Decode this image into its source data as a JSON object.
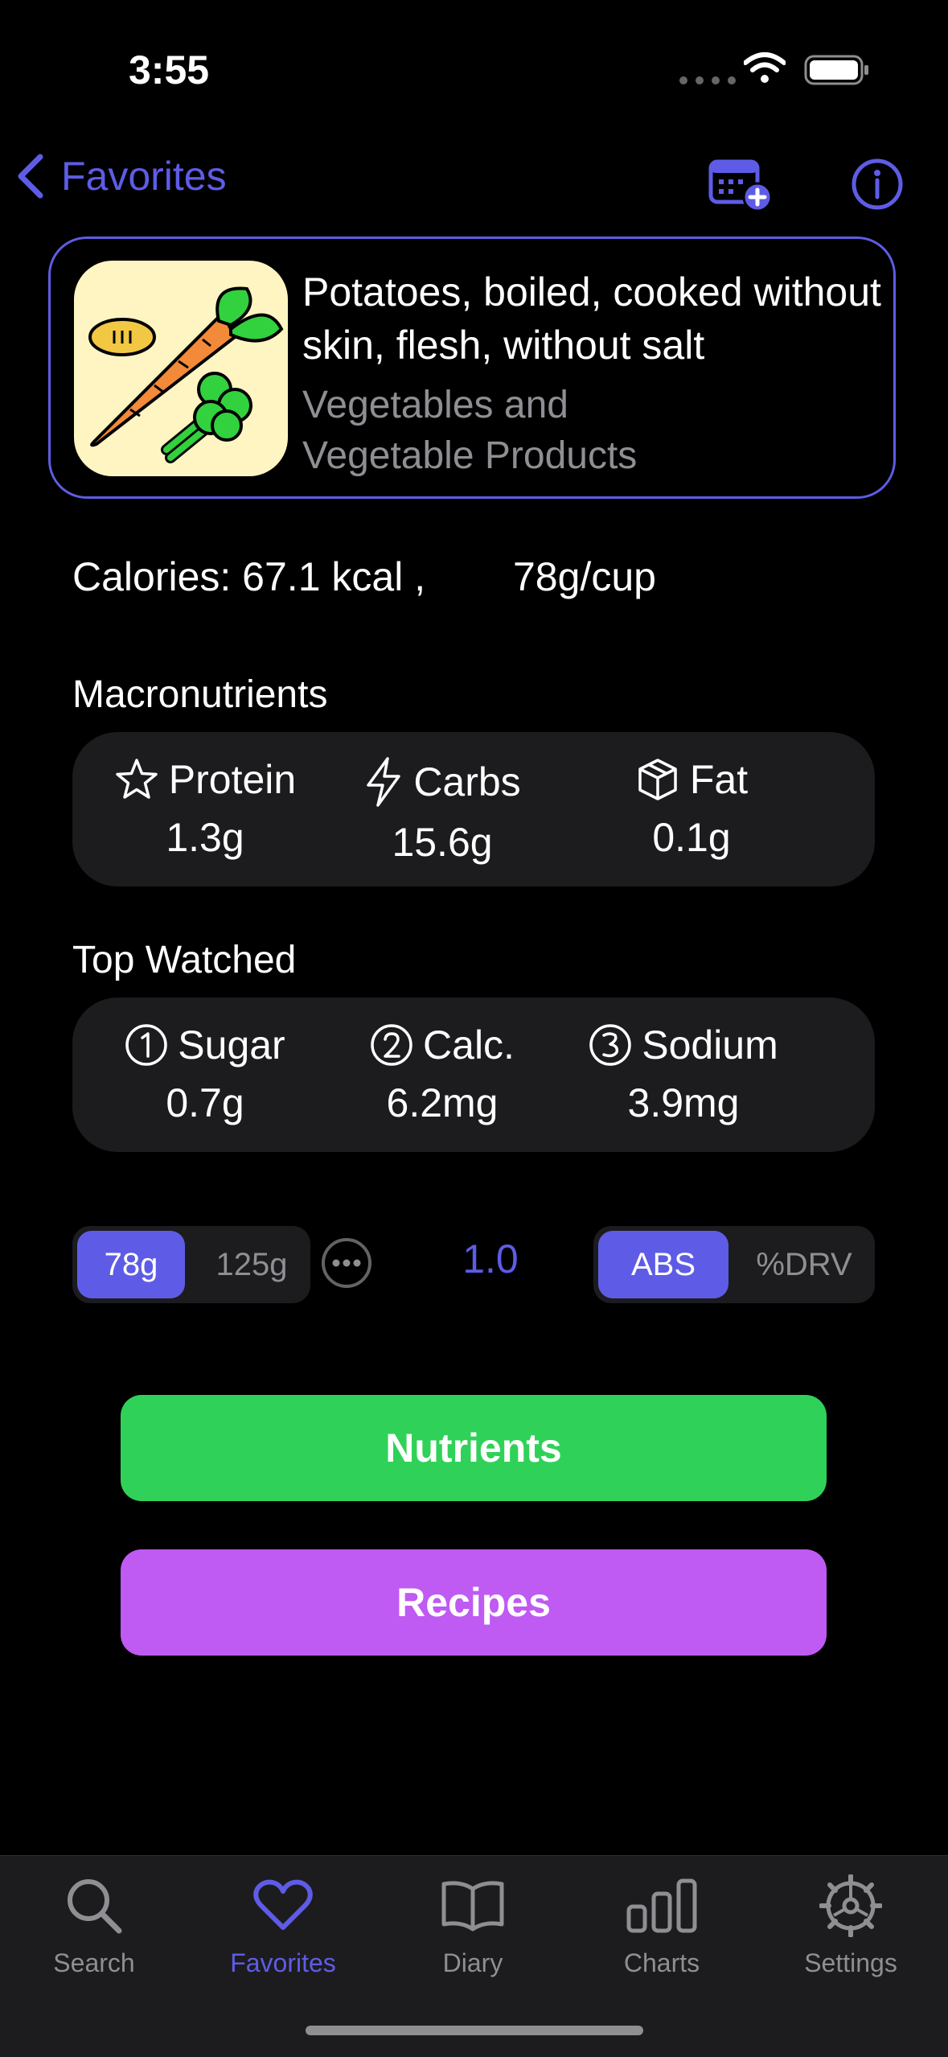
{
  "status_bar": {
    "time": "3:55"
  },
  "nav": {
    "back_label": "Favorites"
  },
  "food": {
    "name": "Potatoes, boiled, cooked without skin, flesh, without salt",
    "category_line1": "Vegetables and",
    "category_line2": "Vegetable Products"
  },
  "summary": {
    "calories": "Calories: 67.1 kcal ,",
    "serving": "78g/cup"
  },
  "macronutrients": {
    "title": "Macronutrients",
    "items": [
      {
        "label": "Protein",
        "value": "1.3g",
        "icon": "star-icon"
      },
      {
        "label": "Carbs",
        "value": "15.6g",
        "icon": "bolt-icon"
      },
      {
        "label": "Fat",
        "value": "0.1g",
        "icon": "cube-icon"
      }
    ]
  },
  "top_watched": {
    "title": "Top Watched",
    "items": [
      {
        "label": "Sugar",
        "value": "0.7g",
        "icon": "circle-1-icon"
      },
      {
        "label": "Calc.",
        "value": "6.2mg",
        "icon": "circle-2-icon"
      },
      {
        "label": "Sodium",
        "value": "3.9mg",
        "icon": "circle-3-icon"
      }
    ]
  },
  "controls": {
    "serving_options": [
      "78g",
      "125g"
    ],
    "selected_serving": "78g",
    "multiplier": "1.0",
    "mode_options": [
      "ABS",
      "%DRV"
    ],
    "selected_mode": "ABS"
  },
  "actions": {
    "nutrients": "Nutrients",
    "recipes": "Recipes"
  },
  "tabs": [
    {
      "label": "Search",
      "icon": "search-icon"
    },
    {
      "label": "Favorites",
      "icon": "heart-icon",
      "active": true
    },
    {
      "label": "Diary",
      "icon": "book-icon"
    },
    {
      "label": "Charts",
      "icon": "chart-icon"
    },
    {
      "label": "Settings",
      "icon": "gear-icon"
    }
  ],
  "colors": {
    "accent": "#5e5ce6",
    "green": "#30d158",
    "purple": "#bf5af2",
    "panel": "#1c1c1e"
  }
}
